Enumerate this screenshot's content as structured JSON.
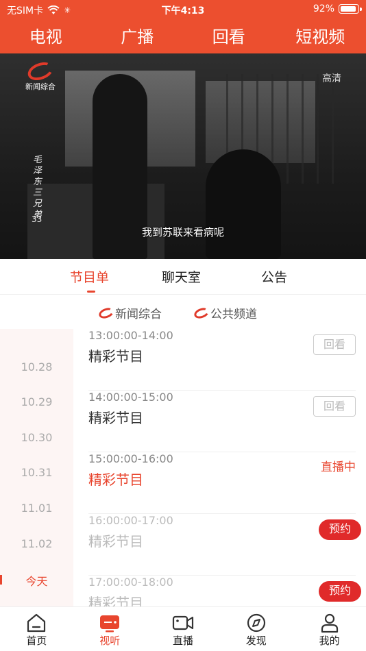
{
  "status": {
    "carrier": "无SIM卡",
    "time": "下午4:13",
    "battery": "92%"
  },
  "top_tabs": [
    "电视",
    "广播",
    "回看",
    "短视频"
  ],
  "video": {
    "channel_logo_text": "新闻综合",
    "quality": "高清",
    "title_vertical": "毛泽东三兄弟",
    "episode": "33",
    "subtitle": "我到苏联来看病呢"
  },
  "sub_tabs": {
    "items": [
      "节目单",
      "聊天室",
      "公告"
    ],
    "active": "节目单"
  },
  "channels": [
    "新闻综合",
    "公共频道"
  ],
  "dates": {
    "items": [
      "10.28",
      "10.29",
      "10.30",
      "10.31",
      "11.01",
      "11.02",
      "今天"
    ],
    "active": "今天"
  },
  "programs": [
    {
      "time": "13:00:00-14:00",
      "name": "精彩节目",
      "action": "回看",
      "state": "past"
    },
    {
      "time": "14:00:00-15:00",
      "name": "精彩节目",
      "action": "回看",
      "state": "past"
    },
    {
      "time": "15:00:00-16:00",
      "name": "精彩节目",
      "action": "直播中",
      "state": "live"
    },
    {
      "time": "16:00:00-17:00",
      "name": "精彩节目",
      "action": "预约",
      "state": "future"
    },
    {
      "time": "17:00:00-18:00",
      "name": "精彩节目",
      "action": "预约",
      "state": "future"
    }
  ],
  "bottom_nav": {
    "items": [
      "首页",
      "视听",
      "直播",
      "发现",
      "我的"
    ],
    "active": "视听"
  },
  "colors": {
    "accent": "#ec4f2f",
    "active_text": "#e8452e",
    "reserve_bg": "#e02a2a"
  }
}
